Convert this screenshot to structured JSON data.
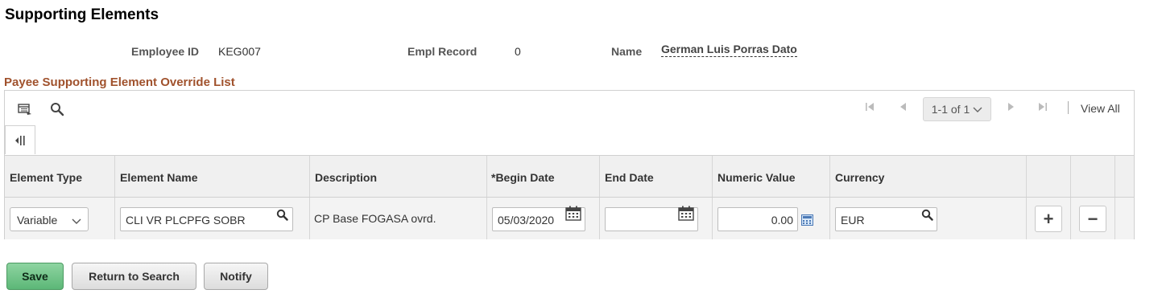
{
  "page": {
    "title": "Supporting Elements"
  },
  "header": {
    "employee_id_label": "Employee ID",
    "employee_id": "KEG007",
    "empl_record_label": "Empl Record",
    "empl_record": "0",
    "name_label": "Name",
    "name": "German Luis Porras Dato"
  },
  "grid": {
    "title": "Payee Supporting Element Override List",
    "pager_text": "1-1 of 1",
    "view_all": "View All",
    "columns": [
      "Element Type",
      "Element Name",
      "Description",
      "*Begin Date",
      "End Date",
      "Numeric Value",
      "Currency"
    ],
    "rows": [
      {
        "element_type": "Variable",
        "element_name": "CLI VR PLCPFG SOBR",
        "description": "CP Base FOGASA ovrd.",
        "begin_date": "05/03/2020",
        "end_date": "",
        "numeric_value": "0.00",
        "currency": "EUR"
      }
    ],
    "add_row_symbol": "+",
    "delete_row_symbol": "−"
  },
  "buttons": {
    "save": "Save",
    "return_to_search": "Return to Search",
    "notify": "Notify"
  },
  "colors": {
    "section_title": "#a0522d",
    "save_button": "#5cb777"
  },
  "icons": [
    "grid-personalize-icon",
    "find-icon",
    "first-page-icon",
    "previous-page-icon",
    "chevron-down-icon",
    "next-page-icon",
    "last-page-icon",
    "collapse-columns-icon",
    "lookup-icon",
    "calendar-icon",
    "calculator-icon"
  ]
}
